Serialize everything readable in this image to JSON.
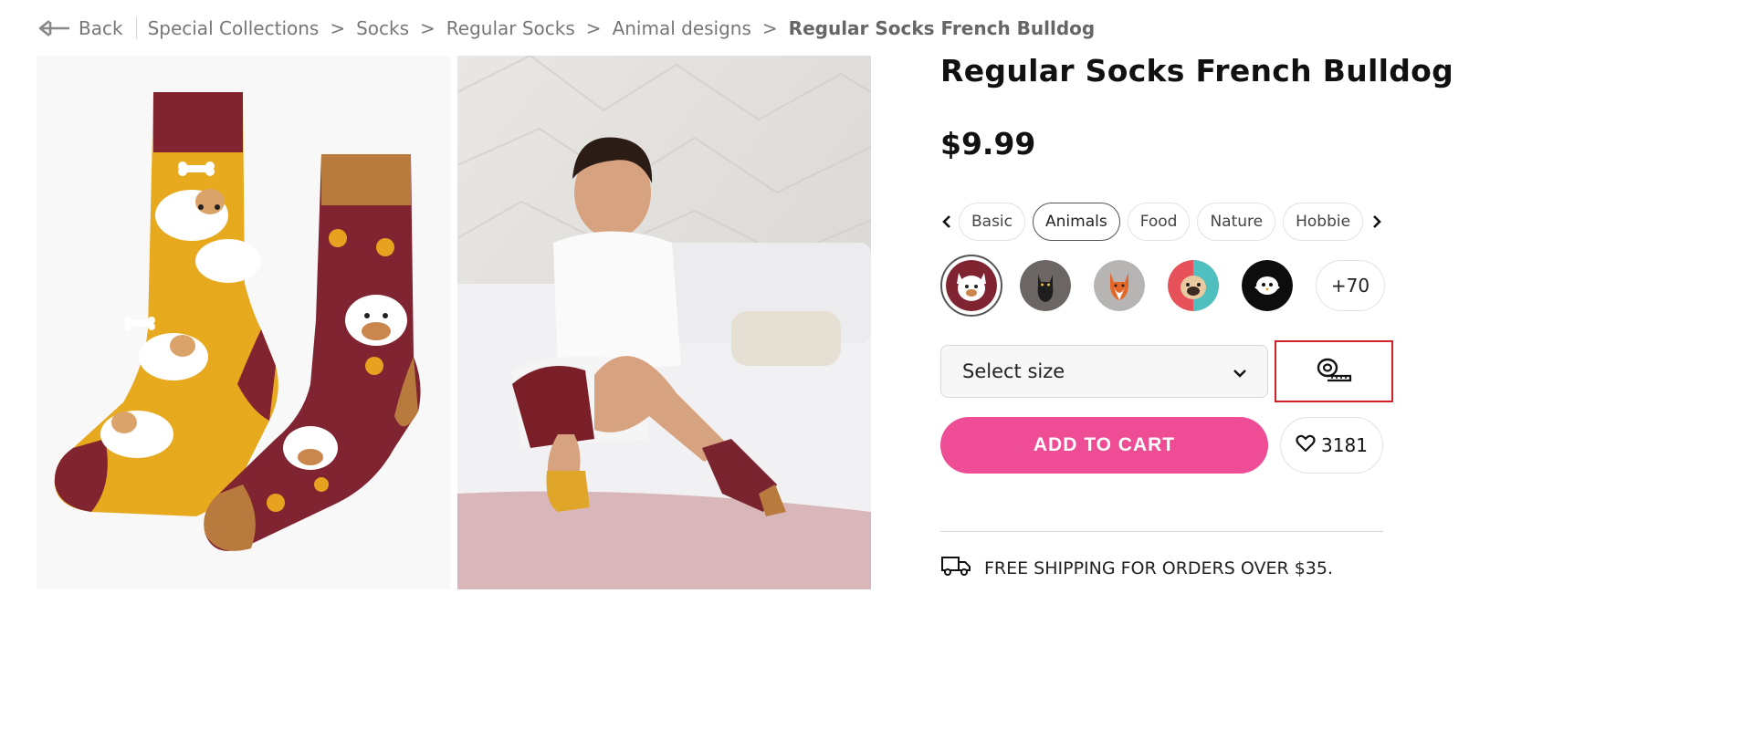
{
  "breadcrumb": {
    "back_label": "Back",
    "items": [
      "Special Collections",
      "Socks",
      "Regular Socks",
      "Animal designs"
    ],
    "separator": ">",
    "current": "Regular Socks French Bulldog"
  },
  "product": {
    "title": "Regular Socks French Bulldog",
    "price": "$9.99"
  },
  "categories": {
    "items": [
      "Basic",
      "Animals",
      "Food",
      "Nature",
      "Hobbie"
    ],
    "active": "Animals"
  },
  "swatches": {
    "items": [
      "french-bulldog",
      "black-cat",
      "fox",
      "pug",
      "penguin"
    ],
    "more_label": "+70"
  },
  "size_select": {
    "label": "Select size"
  },
  "actions": {
    "add_to_cart": "ADD TO CART",
    "wishlist_count": "3181"
  },
  "shipping": {
    "text": "FREE SHIPPING FOR ORDERS OVER $35."
  },
  "colors": {
    "accent_pink": "#ee4d95",
    "sock_mustard": "#e7aa1f",
    "sock_maroon": "#7f2430",
    "sock_tan": "#b87b3d",
    "highlight_red": "#d21f2a"
  }
}
